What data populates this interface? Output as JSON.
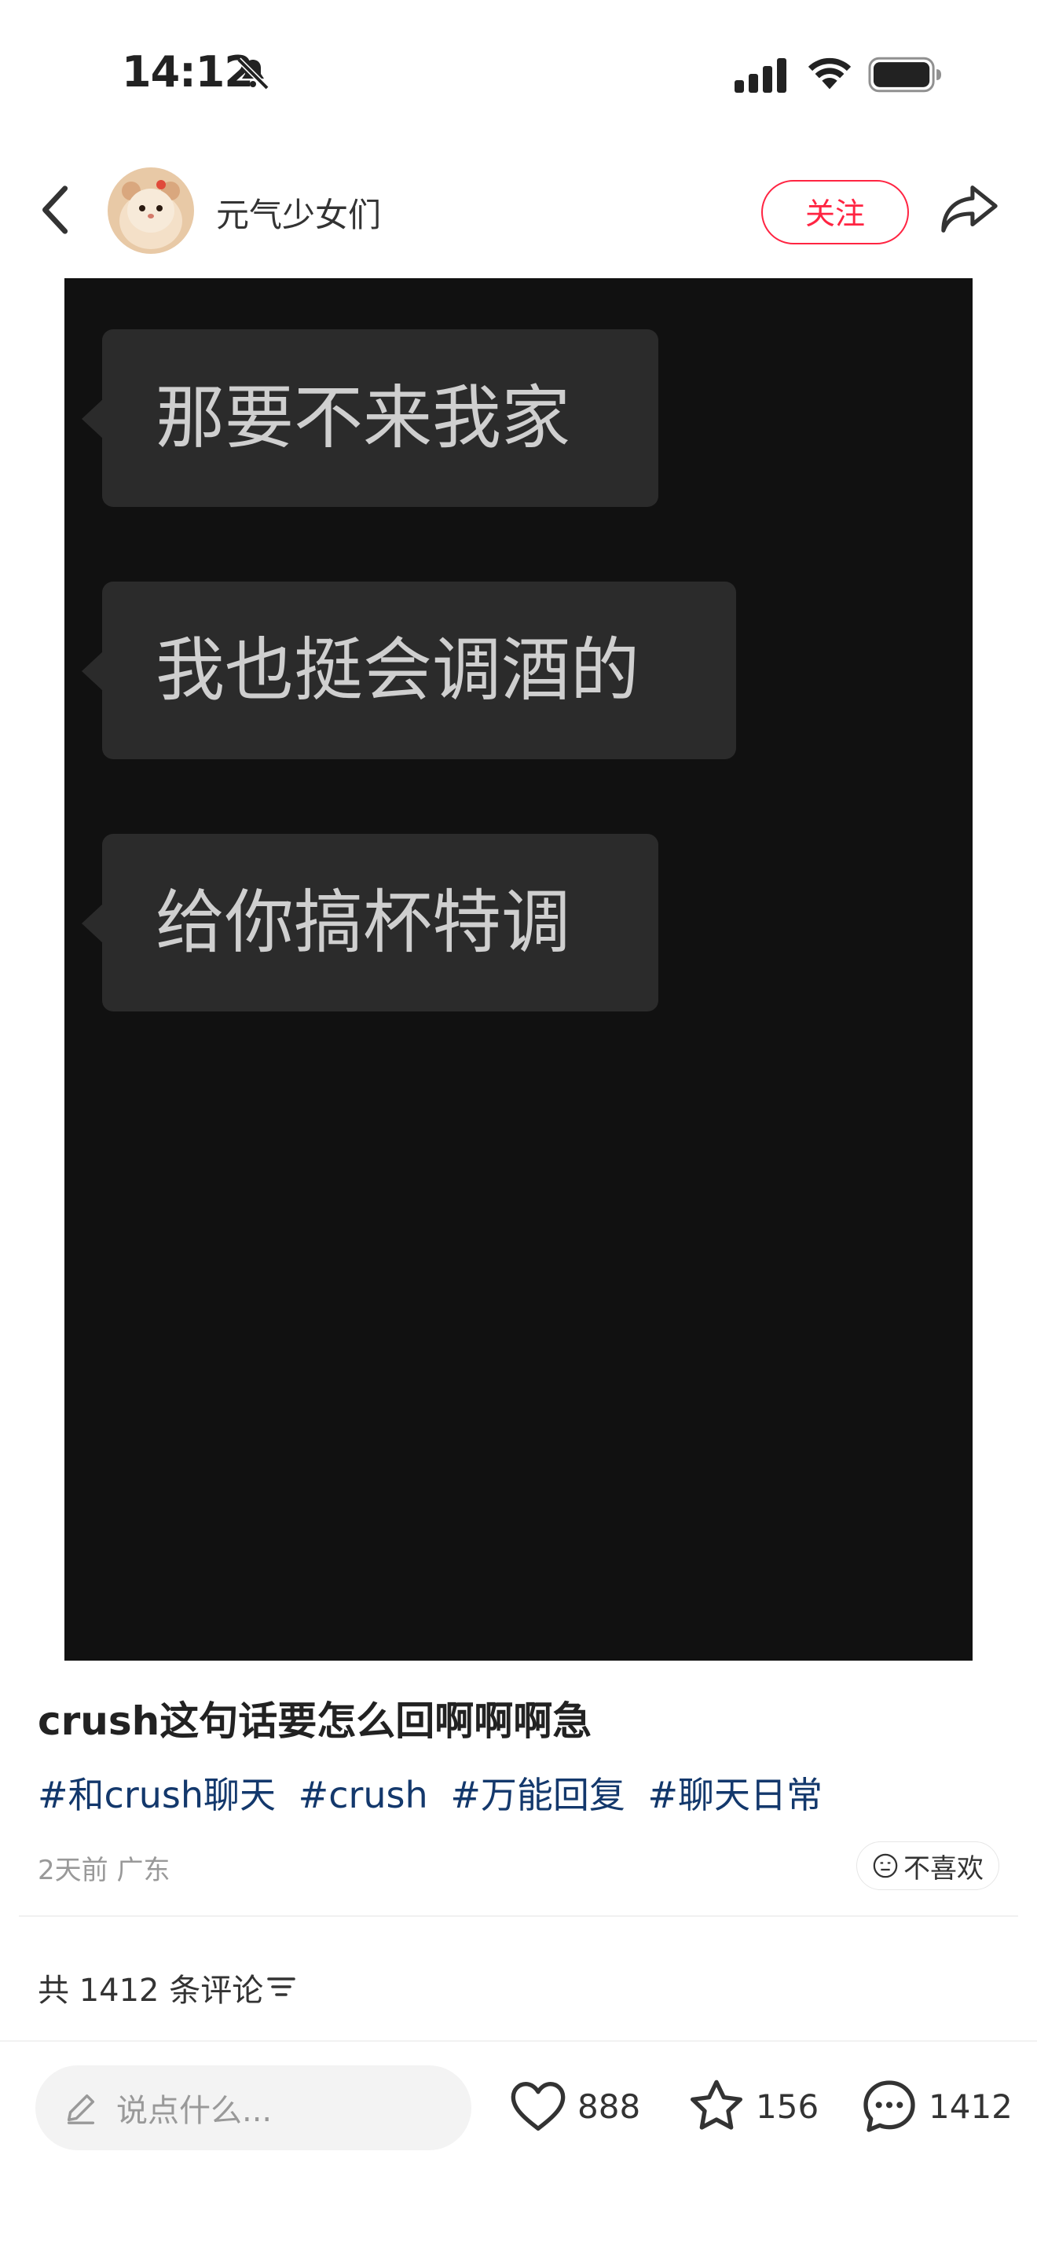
{
  "status_bar": {
    "time": "14:12"
  },
  "header": {
    "author_name": "元气少女们",
    "follow_label": "关注"
  },
  "media": {
    "bubbles": [
      "那要不来我家",
      "我也挺会调酒的",
      "给你搞杯特调"
    ]
  },
  "post": {
    "title": "crush这句话要怎么回啊啊啊急",
    "tags": [
      "#和crush聊天",
      "#crush",
      "#万能回复",
      "#聊天日常"
    ],
    "meta": "2天前 广东",
    "dislike_label": "不喜欢"
  },
  "comments": {
    "count_label": "共 1412 条评论"
  },
  "bottom_bar": {
    "input_placeholder": "说点什么...",
    "likes": "888",
    "collects": "156",
    "comments": "1412"
  },
  "colors": {
    "accent": "#ff2442",
    "tag": "#13386c",
    "media_bg": "#111111",
    "bubble_bg": "#2b2b2b"
  }
}
